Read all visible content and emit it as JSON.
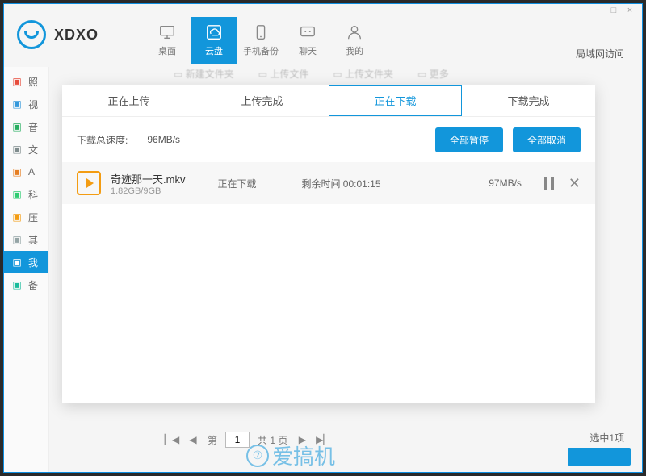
{
  "brand": "XDXO",
  "window_controls": {
    "min": "−",
    "max": "□",
    "close": "×"
  },
  "nav": [
    {
      "label": "桌面",
      "active": false
    },
    {
      "label": "云盘",
      "active": true
    },
    {
      "label": "手机备份",
      "active": false
    },
    {
      "label": "聊天",
      "active": false
    },
    {
      "label": "我的",
      "active": false
    }
  ],
  "lan_link": "局域网访问",
  "sidebar": [
    {
      "label": "照",
      "color": "#e74c3c"
    },
    {
      "label": "视",
      "color": "#3498db"
    },
    {
      "label": "音",
      "color": "#27ae60"
    },
    {
      "label": "文",
      "color": "#7f8c8d"
    },
    {
      "label": "A",
      "color": "#e67e22"
    },
    {
      "label": "科",
      "color": "#2ecc71"
    },
    {
      "label": "压",
      "color": "#f39c12"
    },
    {
      "label": "其",
      "color": "#95a5a6"
    },
    {
      "label": "我",
      "color": "#ffffff",
      "active": true
    },
    {
      "label": "备",
      "color": "#1abc9c"
    }
  ],
  "toolbar_ghost": [
    "新建文件夹",
    "上传文件",
    "上传文件夹",
    "更多"
  ],
  "modal": {
    "tabs": [
      "正在上传",
      "上传完成",
      "正在下载",
      "下载完成"
    ],
    "active_tab": 2,
    "speed_label": "下载总速度:",
    "speed_value": "96MB/s",
    "btn_pause_all": "全部暂停",
    "btn_cancel_all": "全部取消",
    "rows": [
      {
        "filename": "奇迹那一天.mkv",
        "size": "1.82GB/9GB",
        "status": "正在下载",
        "remaining": "剩余时间 00:01:15",
        "speed": "97MB/s"
      }
    ]
  },
  "pager": {
    "label_page": "第",
    "current": "1",
    "total_label": "共 1 页",
    "selected_label": "选中1项"
  },
  "watermark": "爱搞机"
}
